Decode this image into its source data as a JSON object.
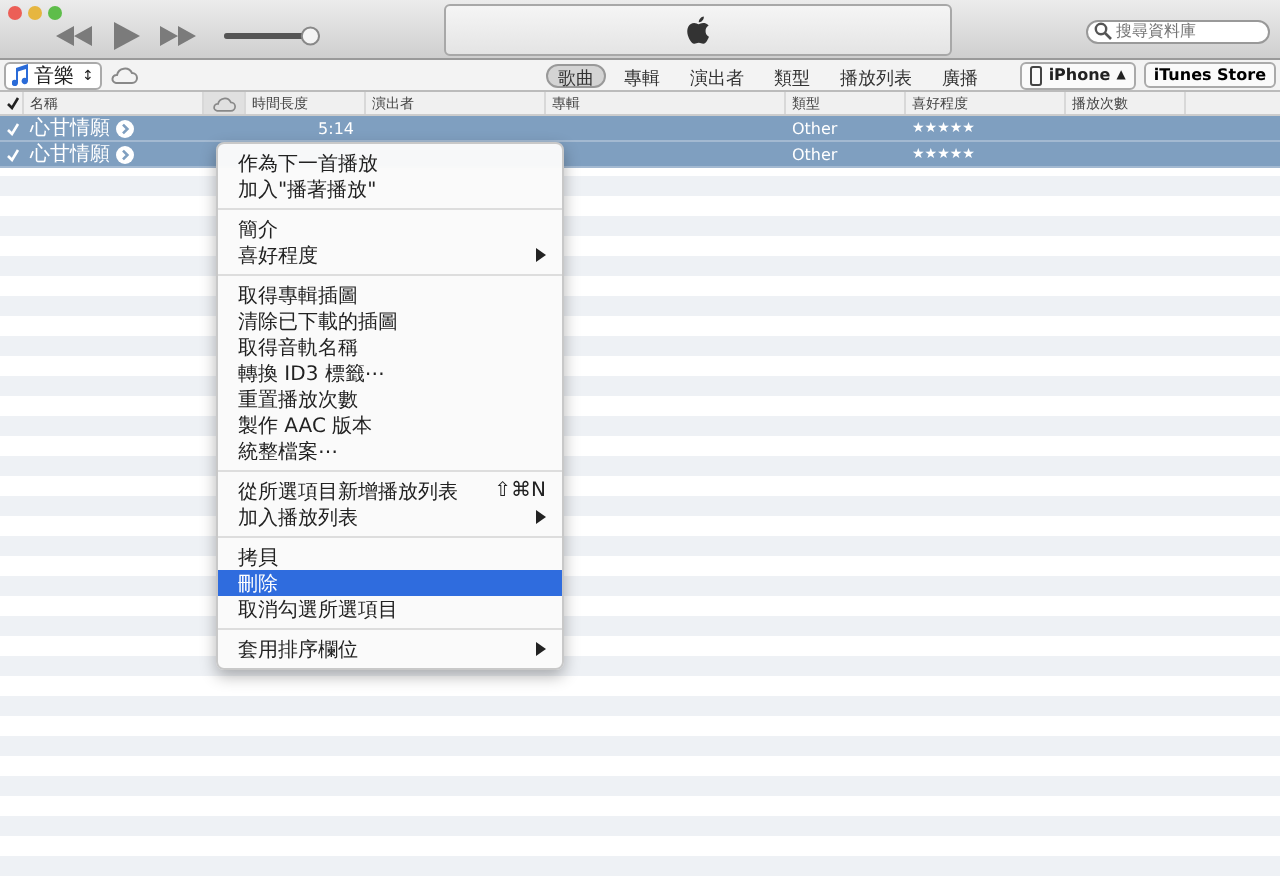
{
  "toolbar": {
    "volume": {
      "level": 0.9
    },
    "search": {
      "placeholder": "搜尋資料庫"
    }
  },
  "source": {
    "label": "音樂",
    "arrows": "↕"
  },
  "tabs": [
    {
      "label": "歌曲",
      "selected": true
    },
    {
      "label": "專輯",
      "selected": false
    },
    {
      "label": "演出者",
      "selected": false
    },
    {
      "label": "類型",
      "selected": false
    },
    {
      "label": "播放列表",
      "selected": false
    },
    {
      "label": "廣播",
      "selected": false
    }
  ],
  "device": {
    "label": "iPhone",
    "eject": "▲"
  },
  "store_button": "iTunes Store",
  "table": {
    "columns": [
      "名稱",
      "時間長度",
      "演出者",
      "專輯",
      "類型",
      "喜好程度",
      "播放次數"
    ],
    "rows": [
      {
        "checked": true,
        "selected": true,
        "name": "心甘情願",
        "time": "5:14",
        "genre": "Other",
        "stars": 5
      },
      {
        "checked": true,
        "selected": true,
        "name": "心甘情願",
        "genre": "Other",
        "stars": 5
      }
    ]
  },
  "menu": [
    {
      "kind": "item",
      "label": "作為下一首播放",
      "submenu": false,
      "selected": false
    },
    {
      "kind": "item",
      "label": "加入\"播著播放\"",
      "submenu": false,
      "selected": false
    },
    {
      "kind": "separator"
    },
    {
      "kind": "item",
      "label": "簡介",
      "submenu": false,
      "selected": false
    },
    {
      "kind": "item",
      "label": "喜好程度",
      "submenu": true,
      "selected": false
    },
    {
      "kind": "separator"
    },
    {
      "kind": "item",
      "label": "取得專輯插圖",
      "submenu": false,
      "selected": false
    },
    {
      "kind": "item",
      "label": "清除已下載的插圖",
      "submenu": false,
      "selected": false
    },
    {
      "kind": "item",
      "label": "取得音軌名稱",
      "submenu": false,
      "selected": false
    },
    {
      "kind": "item",
      "label": "轉換 ID3 標籤⋯",
      "submenu": false,
      "selected": false
    },
    {
      "kind": "item",
      "label": "重置播放次數",
      "submenu": false,
      "selected": false
    },
    {
      "kind": "item",
      "label": "製作 AAC 版本",
      "submenu": false,
      "selected": false
    },
    {
      "kind": "item",
      "label": "統整檔案⋯",
      "submenu": false,
      "selected": false
    },
    {
      "kind": "separator"
    },
    {
      "kind": "item",
      "label": "從所選項目新增播放列表",
      "shortcut": "⇧⌘N",
      "submenu": false,
      "selected": false
    },
    {
      "kind": "item",
      "label": "加入播放列表",
      "submenu": true,
      "selected": false
    },
    {
      "kind": "separator"
    },
    {
      "kind": "item",
      "label": "拷貝",
      "submenu": false,
      "selected": false
    },
    {
      "kind": "item",
      "label": "刪除",
      "submenu": false,
      "selected": true
    },
    {
      "kind": "item",
      "label": "取消勾選所選項目",
      "submenu": false,
      "selected": false
    },
    {
      "kind": "separator"
    },
    {
      "kind": "item",
      "label": "套用排序欄位",
      "submenu": true,
      "selected": false
    }
  ]
}
